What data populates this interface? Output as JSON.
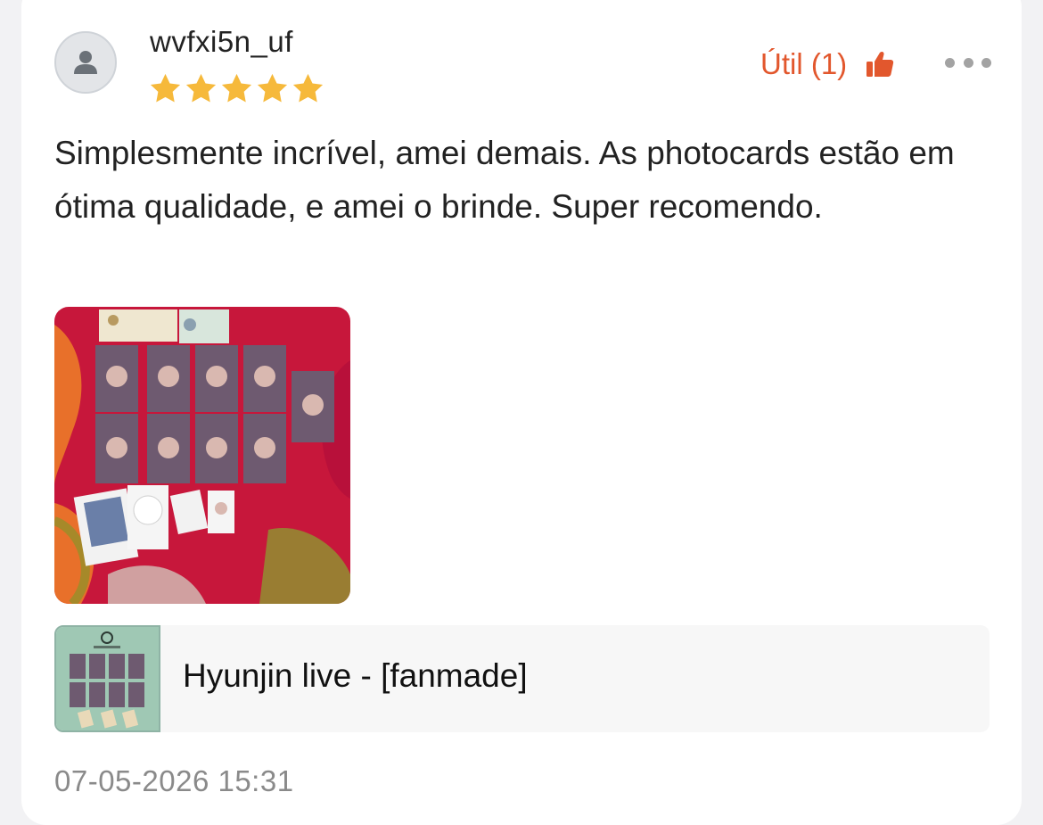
{
  "review": {
    "username": "wvfxi5n_uf",
    "rating": 5,
    "max_rating": 5,
    "star_color": "#f6b93b",
    "helpful_label": "Útil (1)",
    "helpful_color": "#e2572d",
    "text": "Simplesmente incrível, amei demais. As photocards estão em ótima qualidade, e amei o brinde. Super recomendo.",
    "photo_icon": "review-photo-image",
    "product": {
      "title": "Hyunjin live - [fanmade]",
      "thumbnail_icon": "product-thumbnail-image"
    },
    "timestamp": "07-05-2026 15:31"
  }
}
